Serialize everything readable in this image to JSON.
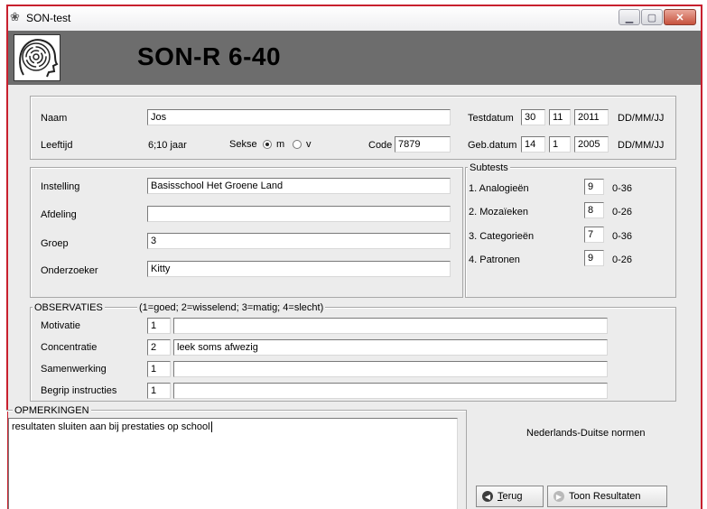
{
  "window": {
    "title": "SON-test"
  },
  "banner": {
    "app_title": "SON-R 6-40"
  },
  "personal": {
    "naam_label": "Naam",
    "naam_value": "Jos",
    "leeftijd_label": "Leeftijd",
    "leeftijd_value": "6;10 jaar",
    "sekse_label": "Sekse",
    "sekse_options": [
      "m",
      "v"
    ],
    "sekse_selected": "m",
    "code_label": "Code",
    "code_value": "7879",
    "testdatum_label": "Testdatum",
    "testdatum": {
      "dd": "30",
      "mm": "11",
      "jj": "2011"
    },
    "gebdatum_label": "Geb.datum",
    "gebdatum": {
      "dd": "14",
      "mm": "1",
      "jj": "2005"
    },
    "date_format": "DD/MM/JJ"
  },
  "institution": {
    "instelling_label": "Instelling",
    "instelling_value": "Basisschool Het Groene Land",
    "afdeling_label": "Afdeling",
    "afdeling_value": "",
    "groep_label": "Groep",
    "groep_value": "3",
    "onderzoeker_label": "Onderzoeker",
    "onderzoeker_value": "Kitty"
  },
  "subtests": {
    "title": "Subtests",
    "items": [
      {
        "label": "1. Analogieën",
        "score": "9",
        "range": "0-36"
      },
      {
        "label": "2. Mozaïeken",
        "score": "8",
        "range": "0-26"
      },
      {
        "label": "3. Categorieën",
        "score": "7",
        "range": "0-36"
      },
      {
        "label": "4. Patronen",
        "score": "9",
        "range": "0-26"
      }
    ]
  },
  "observaties": {
    "title": "OBSERVATIES",
    "legend": "(1=goed; 2=wisselend; 3=matig; 4=slecht)",
    "rows": [
      {
        "label": "Motivatie",
        "score": "1",
        "comment": ""
      },
      {
        "label": "Concentratie",
        "score": "2",
        "comment": "leek soms afwezig"
      },
      {
        "label": "Samenwerking",
        "score": "1",
        "comment": ""
      },
      {
        "label": "Begrip instructies",
        "score": "1",
        "comment": ""
      }
    ]
  },
  "opmerkingen": {
    "title": "OPMERKINGEN",
    "text": "resultaten sluiten aan bij prestaties op school"
  },
  "norms_text": "Nederlands-Duitse normen",
  "buttons": {
    "terug": "Terug",
    "toon_prefix": "Toon ",
    "toon_suffix": "Resultaten"
  },
  "colors": {
    "window_border": "#c8202e",
    "banner": "#6d6d6d",
    "panel_bg": "#ececec"
  }
}
